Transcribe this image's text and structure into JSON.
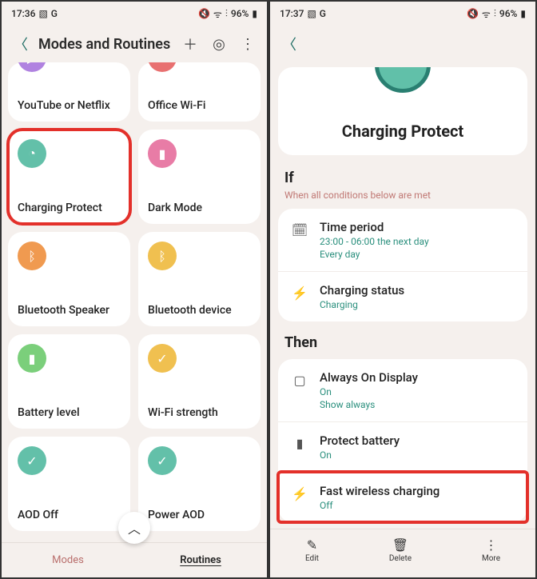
{
  "left": {
    "status": {
      "time": "17:36",
      "battery": "96%"
    },
    "header": {
      "title": "Modes and Routines"
    },
    "tiles": [
      {
        "label": "YouTube or Netflix",
        "icon": "play",
        "color": "bg-purple",
        "short": true,
        "highlight": false
      },
      {
        "label": "Office Wi-Fi",
        "icon": "wifi",
        "color": "bg-red",
        "short": true,
        "highlight": false
      },
      {
        "label": "Charging Protect",
        "icon": "clock",
        "color": "bg-teal",
        "short": false,
        "highlight": true
      },
      {
        "label": "Dark Mode",
        "icon": "battery",
        "color": "bg-pink",
        "short": false,
        "highlight": false
      },
      {
        "label": "Bluetooth Speaker",
        "icon": "bt",
        "color": "bg-orange",
        "short": false,
        "highlight": false
      },
      {
        "label": "Bluetooth device",
        "icon": "bt",
        "color": "bg-yellow",
        "short": false,
        "highlight": false
      },
      {
        "label": "Battery level",
        "icon": "battery",
        "color": "bg-green",
        "short": false,
        "highlight": false
      },
      {
        "label": "Wi-Fi strength",
        "icon": "check",
        "color": "bg-yellow",
        "short": false,
        "highlight": false
      },
      {
        "label": "AOD Off",
        "icon": "check",
        "color": "bg-teal",
        "short": false,
        "highlight": false
      },
      {
        "label": "Power AOD",
        "icon": "check",
        "color": "bg-teal",
        "short": false,
        "highlight": false
      }
    ],
    "nav": {
      "modes": "Modes",
      "routines": "Routines"
    }
  },
  "right": {
    "status": {
      "time": "17:37",
      "battery": "96%"
    },
    "hero_title": "Charging Protect",
    "if_title": "If",
    "if_sub": "When all conditions below are met",
    "if_items": [
      {
        "icon": "calendar",
        "title": "Time period",
        "line1": "23:00 - 06:00 the next day",
        "line2": "Every day"
      },
      {
        "icon": "bolt",
        "title": "Charging status",
        "line1": "Charging",
        "line2": ""
      }
    ],
    "then_title": "Then",
    "then_items": [
      {
        "icon": "screen",
        "title": "Always On Display",
        "line1": "On",
        "line2": "Show always",
        "highlight": false
      },
      {
        "icon": "battery",
        "title": "Protect battery",
        "line1": "On",
        "line2": "",
        "highlight": false
      },
      {
        "icon": "bolt",
        "title": "Fast wireless charging",
        "line1": "Off",
        "line2": "",
        "highlight": true
      }
    ],
    "footer": {
      "edit": "Edit",
      "delete": "Delete",
      "more": "More"
    }
  },
  "icons": {
    "play": "▶",
    "wifi": "ᯤ",
    "clock": "◔",
    "battery": "▮",
    "bt": "ᛒ",
    "check": "✓",
    "calendar": "🗓",
    "bolt": "⚡",
    "screen": "▢",
    "pencil": "✎",
    "trash": "🗑",
    "more": "⋮",
    "plus": "＋",
    "compass": "◎",
    "chevup": "︿",
    "back": "〈",
    "image": "▧",
    "G": "G",
    "mute": "🔇",
    "signal": "📶",
    "batt": "▮"
  }
}
